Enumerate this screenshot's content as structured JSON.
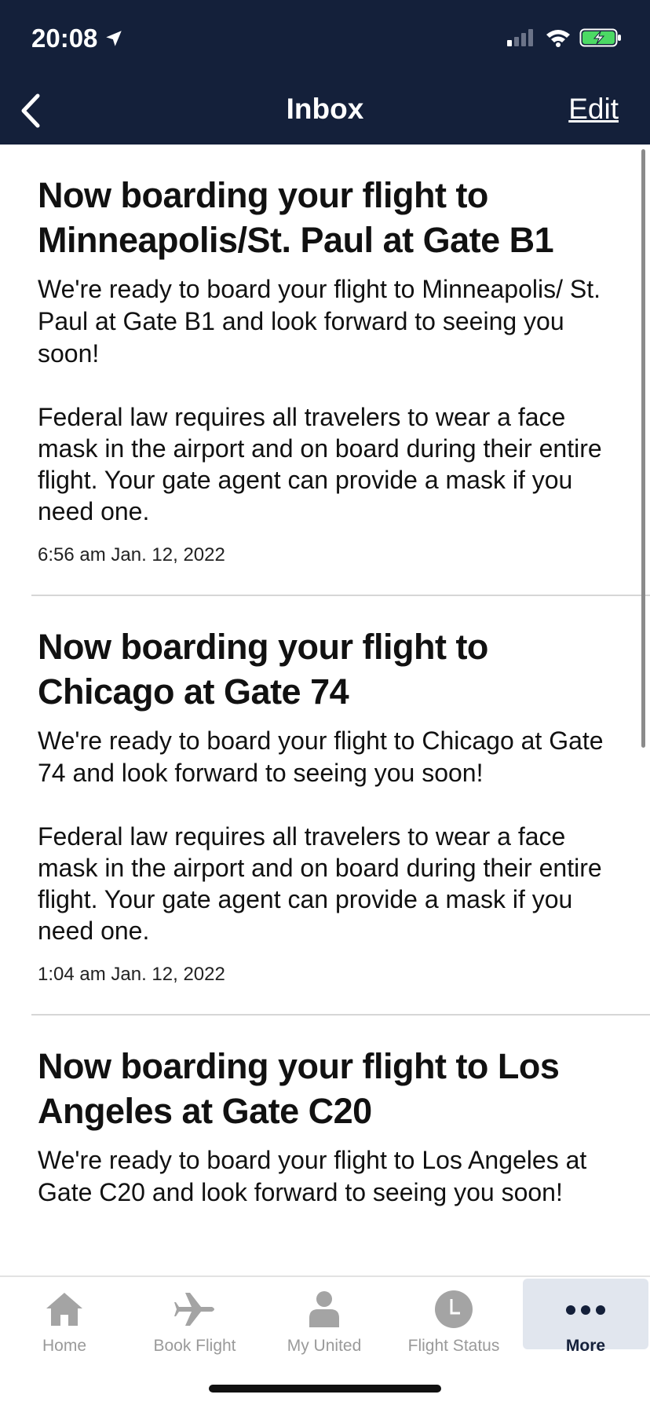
{
  "status": {
    "time": "20:08"
  },
  "nav": {
    "title": "Inbox",
    "edit_label": "Edit"
  },
  "messages": [
    {
      "title": "Now boarding your flight to Minneapolis/St. Paul at Gate B1",
      "body": "We're ready to board your flight to Minneapolis/ St. Paul at Gate B1 and look forward to seeing you soon!",
      "notice": "Federal law requires all travelers to wear a face mask in the airport and on board during their entire flight. Your gate agent can provide a mask if you need one.",
      "timestamp": "6:56 am Jan. 12, 2022"
    },
    {
      "title": "Now boarding your flight to Chicago at Gate 74",
      "body": "We're ready to board your flight to Chicago at Gate 74 and look forward to seeing you soon!",
      "notice": "Federal law requires all travelers to wear a face mask in the airport and on board during their entire flight. Your gate agent can provide a mask if you need one.",
      "timestamp": "1:04 am Jan. 12, 2022"
    },
    {
      "title": "Now boarding your flight to Los Angeles at Gate C20",
      "body": "We're ready to board your flight to Los Angeles at Gate C20 and look forward to seeing you soon!"
    }
  ],
  "tabs": [
    {
      "label": "Home",
      "icon": "home-icon"
    },
    {
      "label": "Book Flight",
      "icon": "airplane-icon"
    },
    {
      "label": "My United",
      "icon": "person-icon"
    },
    {
      "label": "Flight Status",
      "icon": "clock-icon"
    },
    {
      "label": "More",
      "icon": "more-dots-icon",
      "active": true
    }
  ],
  "colors": {
    "nav_background": "#14203a",
    "active_tab_background": "#e1e6ee",
    "tab_inactive": "#9a9a9a"
  }
}
